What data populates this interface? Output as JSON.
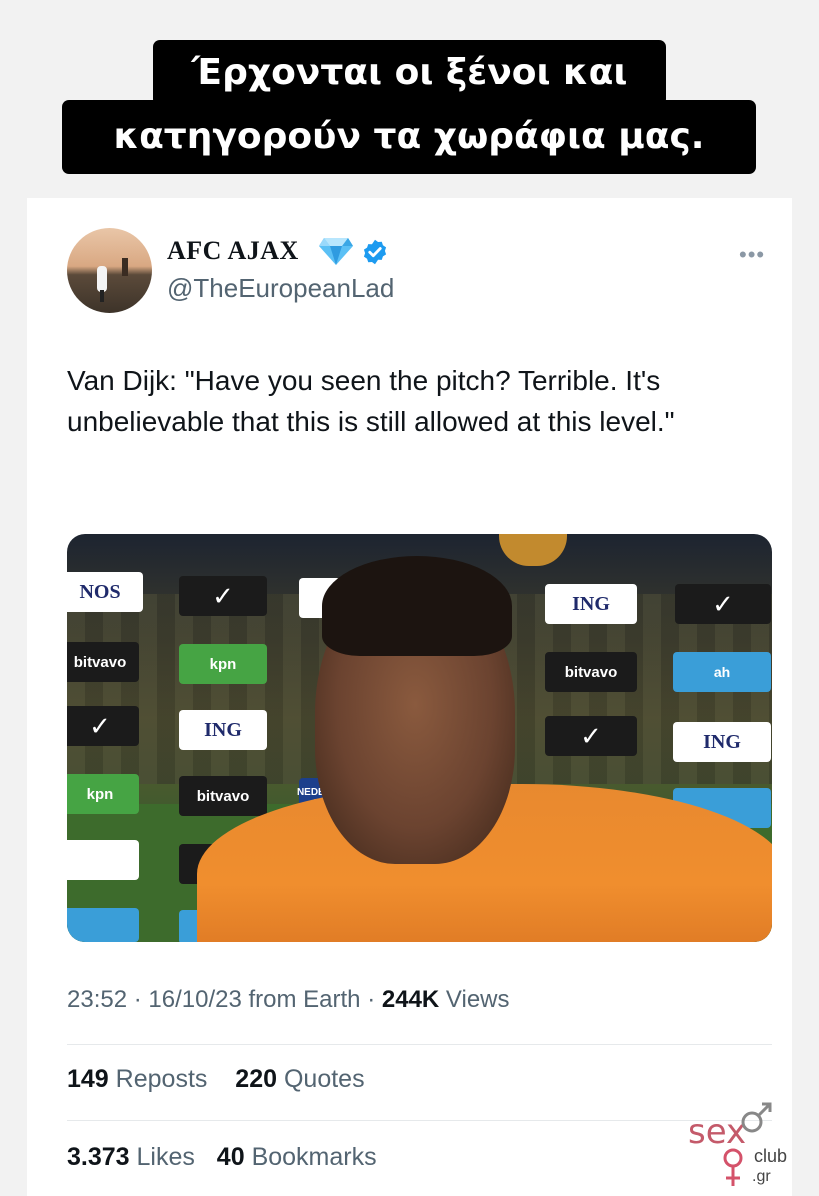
{
  "caption": {
    "line1": "Έρχονται οι ξένοι και",
    "line2": "κατηγορούν τα χωράφια μας."
  },
  "tweet": {
    "display_name": "AFC AJAX",
    "handle": "@TheEuropeanLad",
    "more_label": "•••",
    "text": "Van Dijk: \"Have you seen the pitch? Terrible. It's unbelievable that this is still allowed at this level.\"",
    "time": "23:52",
    "date": "16/10/23",
    "source": "from Earth",
    "views_count": "244K",
    "views_label": "Views",
    "reposts_count": "149",
    "reposts_label": "Reposts",
    "quotes_count": "220",
    "quotes_label": "Quotes",
    "likes_count": "3.373",
    "likes_label": "Likes",
    "bookmarks_count": "40",
    "bookmarks_label": "Bookmarks"
  },
  "media_ads": {
    "ing": "ING",
    "bitvavo": "bitvavo",
    "kpn": "kpn",
    "ah": "ah",
    "nederlandse_loterij": "NEDERLANDSE LOTERIJ",
    "nos": "NOS"
  },
  "watermark": {
    "sex": "sex",
    "club": "club",
    "tld": ".gr"
  },
  "colors": {
    "verified_blue": "#1d9bf0",
    "text_primary": "#0f1419",
    "text_secondary": "#536471",
    "shirt_orange": "#f08e2e"
  },
  "icons": [
    "diamond-icon",
    "verified-badge-icon",
    "more-options-icon",
    "gender-symbol-icon"
  ]
}
